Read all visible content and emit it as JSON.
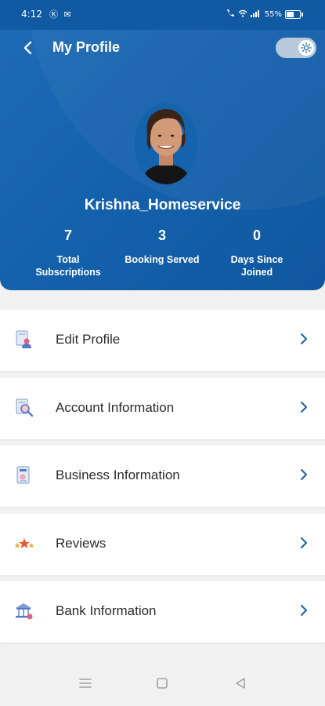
{
  "status_bar": {
    "time": "4:12",
    "left_icons": "Ⓚ ✉",
    "right_text": "55%",
    "icons": [
      "call-icon",
      "wifi-icon",
      "signal-icon",
      "battery-icon"
    ]
  },
  "header": {
    "title": "My Profile",
    "back_icon": "back-arrow-icon",
    "theme_toggle": {
      "state": "on",
      "icon": "sun-icon"
    },
    "username": "Krishna_Homeservice",
    "avatar": "profile-photo",
    "stats": [
      {
        "value": "7",
        "label": "Total\nSubscriptions"
      },
      {
        "value": "3",
        "label": "Booking Served"
      },
      {
        "value": "0",
        "label": "Days Since\nJoined"
      }
    ]
  },
  "menu": [
    {
      "label": "Edit Profile",
      "icon": "edit-profile-icon"
    },
    {
      "label": "Account Information",
      "icon": "account-search-icon"
    },
    {
      "label": "Business Information",
      "icon": "business-document-icon"
    },
    {
      "label": "Reviews",
      "icon": "reviews-stars-icon"
    },
    {
      "label": "Bank Information",
      "icon": "bank-icon"
    }
  ],
  "colors": {
    "header_blue": "#1461ac",
    "chevron_blue": "#1a5fa6",
    "background": "#f1f1f1"
  },
  "nav_bar": [
    "menu-icon",
    "home-square-icon",
    "back-triangle-icon"
  ]
}
